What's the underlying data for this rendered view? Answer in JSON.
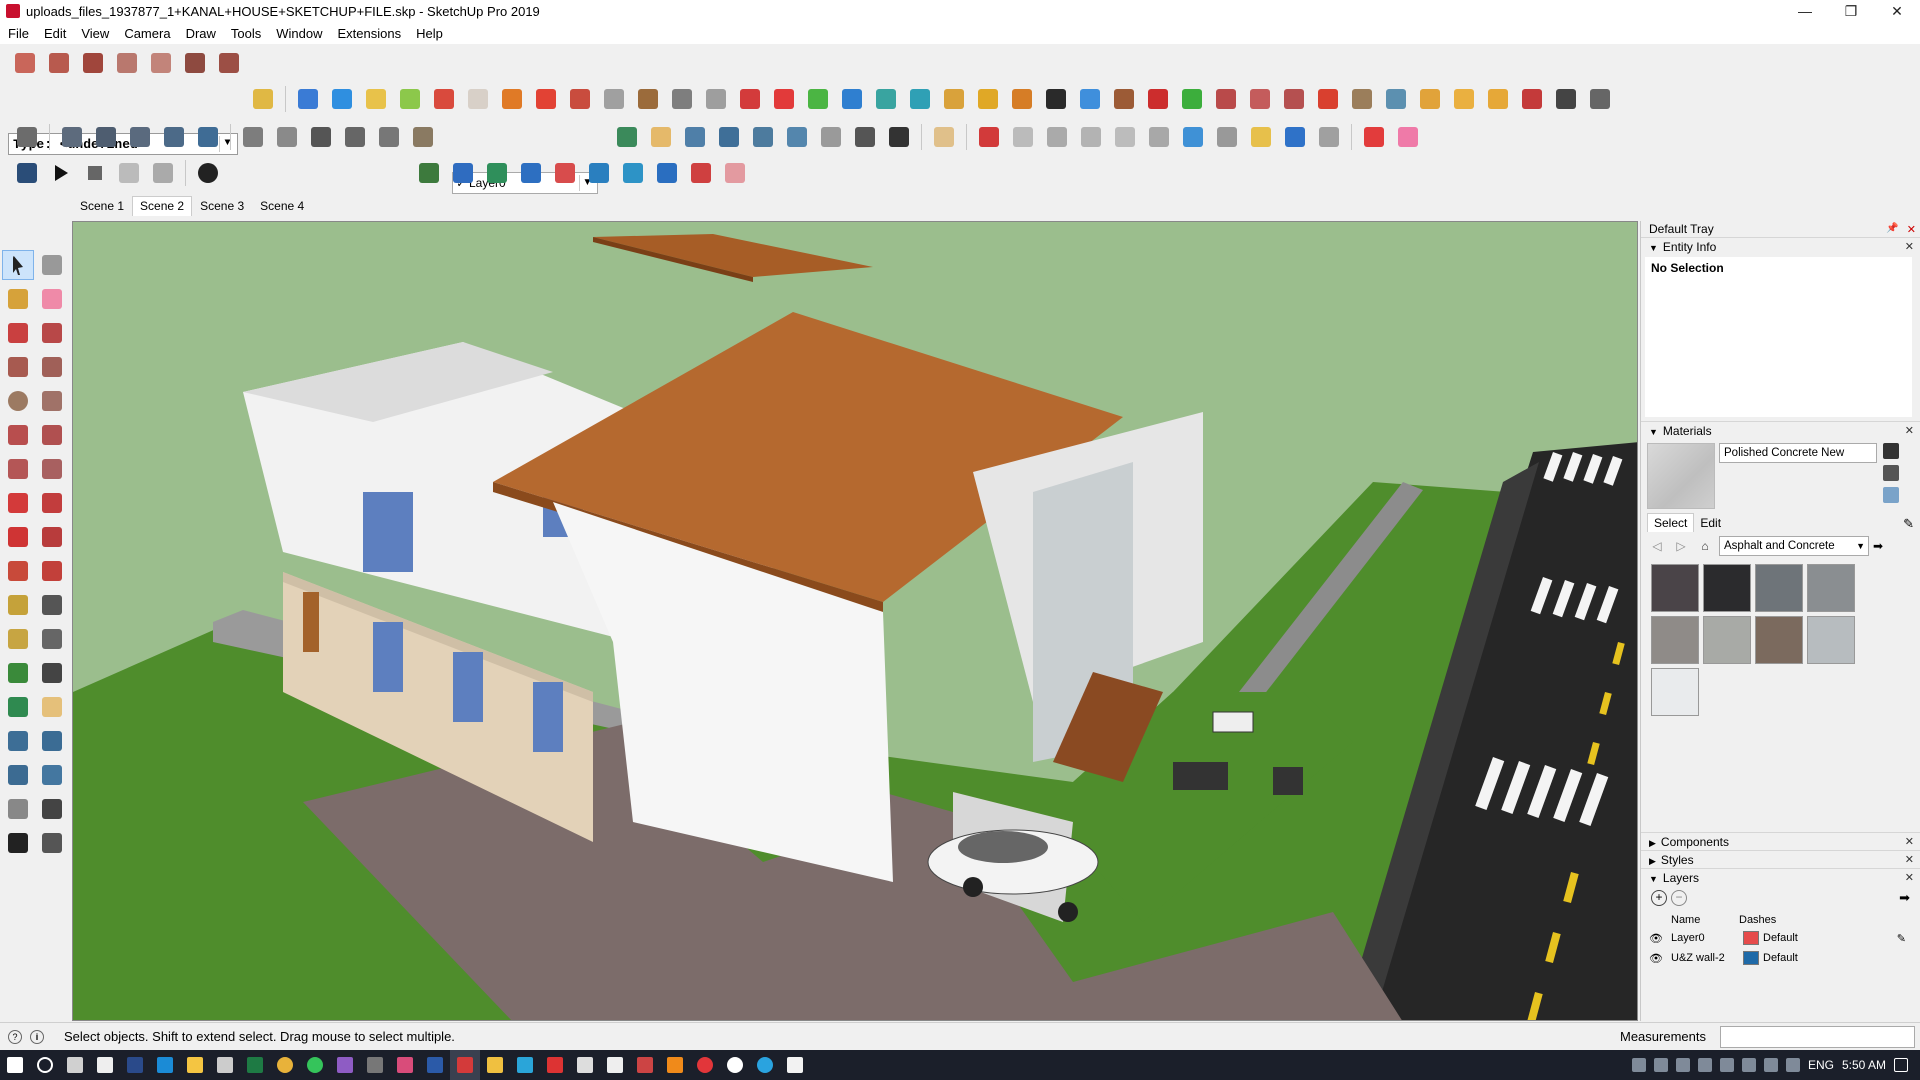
{
  "window": {
    "title": "uploads_files_1937877_1+KANAL+HOUSE+SKETCHUP+FILE.skp - SketchUp Pro 2019",
    "controls": [
      "—",
      "❐",
      "✕"
    ]
  },
  "menu": [
    "File",
    "Edit",
    "View",
    "Camera",
    "Draw",
    "Tools",
    "Window",
    "Extensions",
    "Help"
  ],
  "toolbar": {
    "type_combo": "Type: <undefined>",
    "layer_combo": "Layer0"
  },
  "scenes": [
    "Scene 1",
    "Scene 2",
    "Scene 3",
    "Scene 4"
  ],
  "active_scene": "Scene 2",
  "tray": {
    "title": "Default Tray",
    "entity_info": {
      "header": "Entity Info",
      "body": "No Selection"
    },
    "materials": {
      "header": "Materials",
      "name": "Polished Concrete New",
      "tab_select": "Select",
      "tab_edit": "Edit",
      "library": "Asphalt and Concrete",
      "swatch_colors": [
        "#4a4448",
        "#2b2b2d",
        "#6e7479",
        "#8a8e91",
        "#8f8b88",
        "#a8aaa6",
        "#7b6a5e",
        "#b7bcbf",
        "#e9ebed"
      ]
    },
    "components": {
      "header": "Components"
    },
    "styles": {
      "header": "Styles"
    },
    "layers": {
      "header": "Layers",
      "col_name": "Name",
      "col_dashes": "Dashes",
      "rows": [
        {
          "name": "Layer0",
          "color": "#e64b4b",
          "dashes": "Default"
        },
        {
          "name": "U&Z wall-2",
          "color": "#1f6aa8",
          "dashes": "Default"
        }
      ]
    }
  },
  "status": {
    "message": "Select objects. Shift to extend select. Drag mouse to select multiple.",
    "measurements_label": "Measurements"
  },
  "taskbar": {
    "lang": "ENG",
    "time": "5:50 AM"
  }
}
